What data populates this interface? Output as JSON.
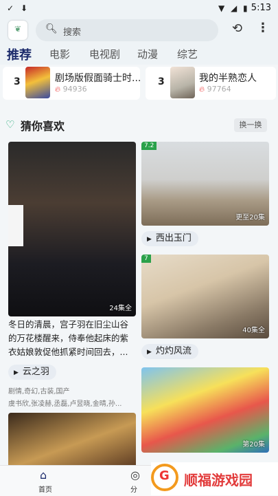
{
  "status_bar": {
    "time": "5:13",
    "icons": [
      "check-icon",
      "download-icon",
      "wifi-icon",
      "signal-icon",
      "battery-icon"
    ]
  },
  "header": {
    "search_placeholder": "搜索",
    "icons": [
      "app-logo",
      "search-icon",
      "history-icon",
      "more-icon"
    ]
  },
  "tabs": [
    "推荐",
    "电影",
    "电视剧",
    "动漫",
    "综艺"
  ],
  "ranking": [
    {
      "rank": "3",
      "title": "剧场版假面骑士时...",
      "heat": "94936"
    },
    {
      "rank": "3",
      "title": "我的半熟恋人",
      "heat": "97764"
    }
  ],
  "section": {
    "title": "猜你喜欢",
    "refresh_label": "换一换"
  },
  "cards": [
    {
      "title": "云之羽",
      "episodes": "24集全",
      "description": "冬日的清晨，宫子羽在旧尘山谷的万花楼醒来，侍奉他起床的紫衣姑娘敦促他抓紧时间回去，...",
      "tags": "剧情,奇幻,古装,国产",
      "cast": "虞书欣,张凌赫,丞磊,卢昱晓,金晴,孙..."
    },
    {
      "title": "西出玉门",
      "episodes": "更至20集",
      "score": "7.2"
    },
    {
      "title": "灼灼风流",
      "episodes": "40集全",
      "score": "7"
    },
    {
      "title": "",
      "episodes": "第20集"
    }
  ],
  "bottom_nav": [
    "首页",
    "分"
  ],
  "watermark": {
    "text": "顺福游戏园"
  },
  "colors": {
    "accent": "#1b2a6b",
    "score_badge": "#2aa14a",
    "heat": "#e44444",
    "watermark": "#e23b3b"
  }
}
